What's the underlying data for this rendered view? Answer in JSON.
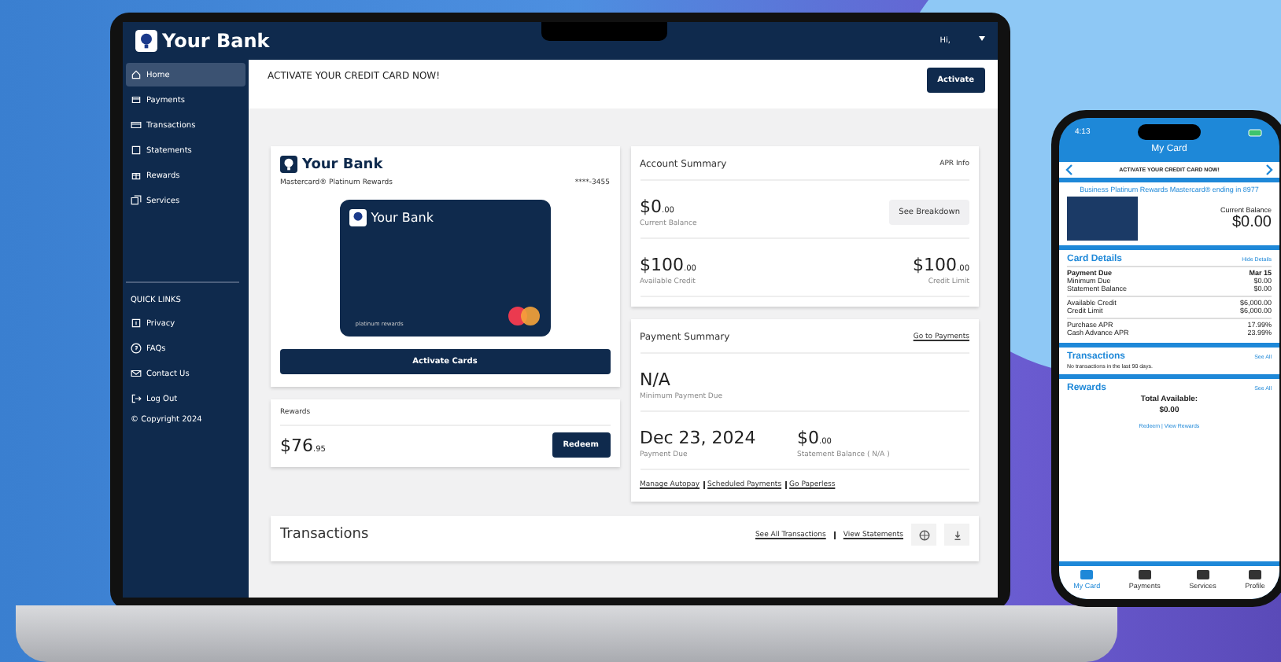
{
  "laptop": {
    "brand": "Your Bank",
    "greeting": "Hi,",
    "nav": [
      {
        "label": "Home",
        "selected": true
      },
      {
        "label": "Payments",
        "selected": false
      },
      {
        "label": "Transactions",
        "selected": false
      },
      {
        "label": "Statements",
        "selected": false
      },
      {
        "label": "Rewards",
        "selected": false
      },
      {
        "label": "Services",
        "selected": false
      }
    ],
    "quick_links": {
      "title": "QUICK LINKS",
      "links": [
        "Privacy",
        "FAQs",
        "Contact Us",
        "Log Out"
      ],
      "copyright": "© Copyright 2024"
    },
    "banner": {
      "text": "ACTIVATE YOUR CREDIT CARD NOW!",
      "button": "Activate"
    },
    "card_panel": {
      "brand": "Your Bank",
      "card_name": "Mastercard® Platinum Rewards",
      "card_number": "****-3455",
      "card_brand": "Your Bank",
      "card_label": "platinum rewards",
      "button": "Activate Cards"
    },
    "rewards": {
      "label": "Rewards",
      "amount": "$76",
      "cents": ".95",
      "button": "Redeem"
    },
    "account_summary": {
      "title": "Account Summary",
      "link": "APR Info",
      "current_balance": {
        "amount": "$0",
        "cents": ".00",
        "label": "Current Balance"
      },
      "button": "See Breakdown",
      "available_credit": {
        "amount": "$100",
        "cents": ".00",
        "label": "Available Credit"
      },
      "credit_limit": {
        "amount": "$100",
        "cents": ".00",
        "label": "Credit Limit"
      }
    },
    "payment_summary": {
      "title": "Payment Summary",
      "link": "Go to Payments",
      "minimum": {
        "value": "N/A",
        "label": "Minimum Payment Due"
      },
      "due_date": {
        "value": "Dec 23, 2024",
        "label": "Payment Due"
      },
      "statement": {
        "amount": "$0",
        "cents": ".00",
        "label": "Statement Balance ( N/A )"
      },
      "links": [
        "Manage Autopay",
        "Scheduled Payments",
        "Go Paperless"
      ]
    },
    "transactions": {
      "title": "Transactions",
      "links": [
        "See All Transactions",
        "View Statements"
      ]
    }
  },
  "phone": {
    "time": "4:13",
    "title": "My Card",
    "banner": "ACTIVATE YOUR CREDIT CARD NOW!",
    "card_caption": "Business Platinum Rewards Mastercard® ending in 8977",
    "balance_label": "Current Balance",
    "balance": "$0.00",
    "card_details": {
      "title": "Card Details",
      "link": "Hide Details",
      "groups": [
        [
          {
            "kind": "header",
            "label": "Payment Due",
            "value": "Mar 15"
          },
          {
            "kind": "row",
            "label": "Minimum Due",
            "value": "$0.00"
          },
          {
            "kind": "row",
            "label": "Statement Balance",
            "value": "$0.00"
          }
        ],
        [
          {
            "kind": "row",
            "label": "Available Credit",
            "value": "$6,000.00"
          },
          {
            "kind": "row",
            "label": "Credit Limit",
            "value": "$6,000.00"
          }
        ],
        [
          {
            "kind": "row",
            "label": "Purchase APR",
            "value": "17.99%"
          },
          {
            "kind": "row",
            "label": "Cash Advance APR",
            "value": "23.99%"
          }
        ]
      ]
    },
    "transactions": {
      "title": "Transactions",
      "link": "See All",
      "empty": "No transactions in the last 90 days."
    },
    "rewards": {
      "title": "Rewards",
      "link": "See All",
      "total_label": "Total Available:",
      "total": "$0.00",
      "links": "Redeem | View Rewards"
    },
    "tabs": [
      {
        "label": "My Card",
        "selected": true
      },
      {
        "label": "Payments",
        "selected": false
      },
      {
        "label": "Services",
        "selected": false
      },
      {
        "label": "Profile",
        "selected": false
      }
    ]
  }
}
